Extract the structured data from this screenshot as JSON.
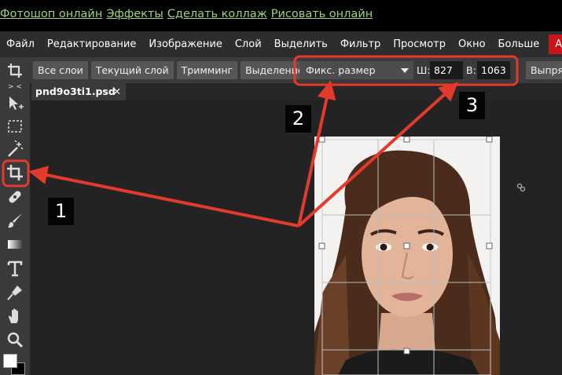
{
  "top_links": [
    "Фотошоп онлайн",
    "Эффекты",
    "Сделать коллаж",
    "Рисовать онлайн"
  ],
  "menu": [
    "Файл",
    "Редактирование",
    "Изображение",
    "Слой",
    "Выделить",
    "Фильтр",
    "Просмотр",
    "Окно",
    "Больше",
    "Аккаунт"
  ],
  "options": {
    "buttons": [
      "Все слои",
      "Текущий слой",
      "Тримминг",
      "Выделение"
    ],
    "mode_select": "Фикс. размер",
    "width_label": "Ш:",
    "width_value": "827",
    "height_label": "В:",
    "height_value": "1063",
    "right_button": "Выпрям"
  },
  "toolbar": {
    "collapse": "> <",
    "tools": [
      "move-tool-icon",
      "marquee-tool-icon",
      "magic-wand-icon",
      "crop-tool-icon",
      "healing-brush-icon",
      "brush-icon",
      "gradient-icon",
      "text-tool-icon",
      "pen-tool-icon",
      "hand-tool-icon",
      "zoom-icon"
    ]
  },
  "tab": {
    "filename": "pnd9o3ti1.psd",
    "close": "✕"
  },
  "annotations": [
    "1",
    "2",
    "3"
  ],
  "colors": {
    "annotation_red": "#e43a2c",
    "account_red": "#c8151b",
    "link_green": "#9fd37a"
  }
}
